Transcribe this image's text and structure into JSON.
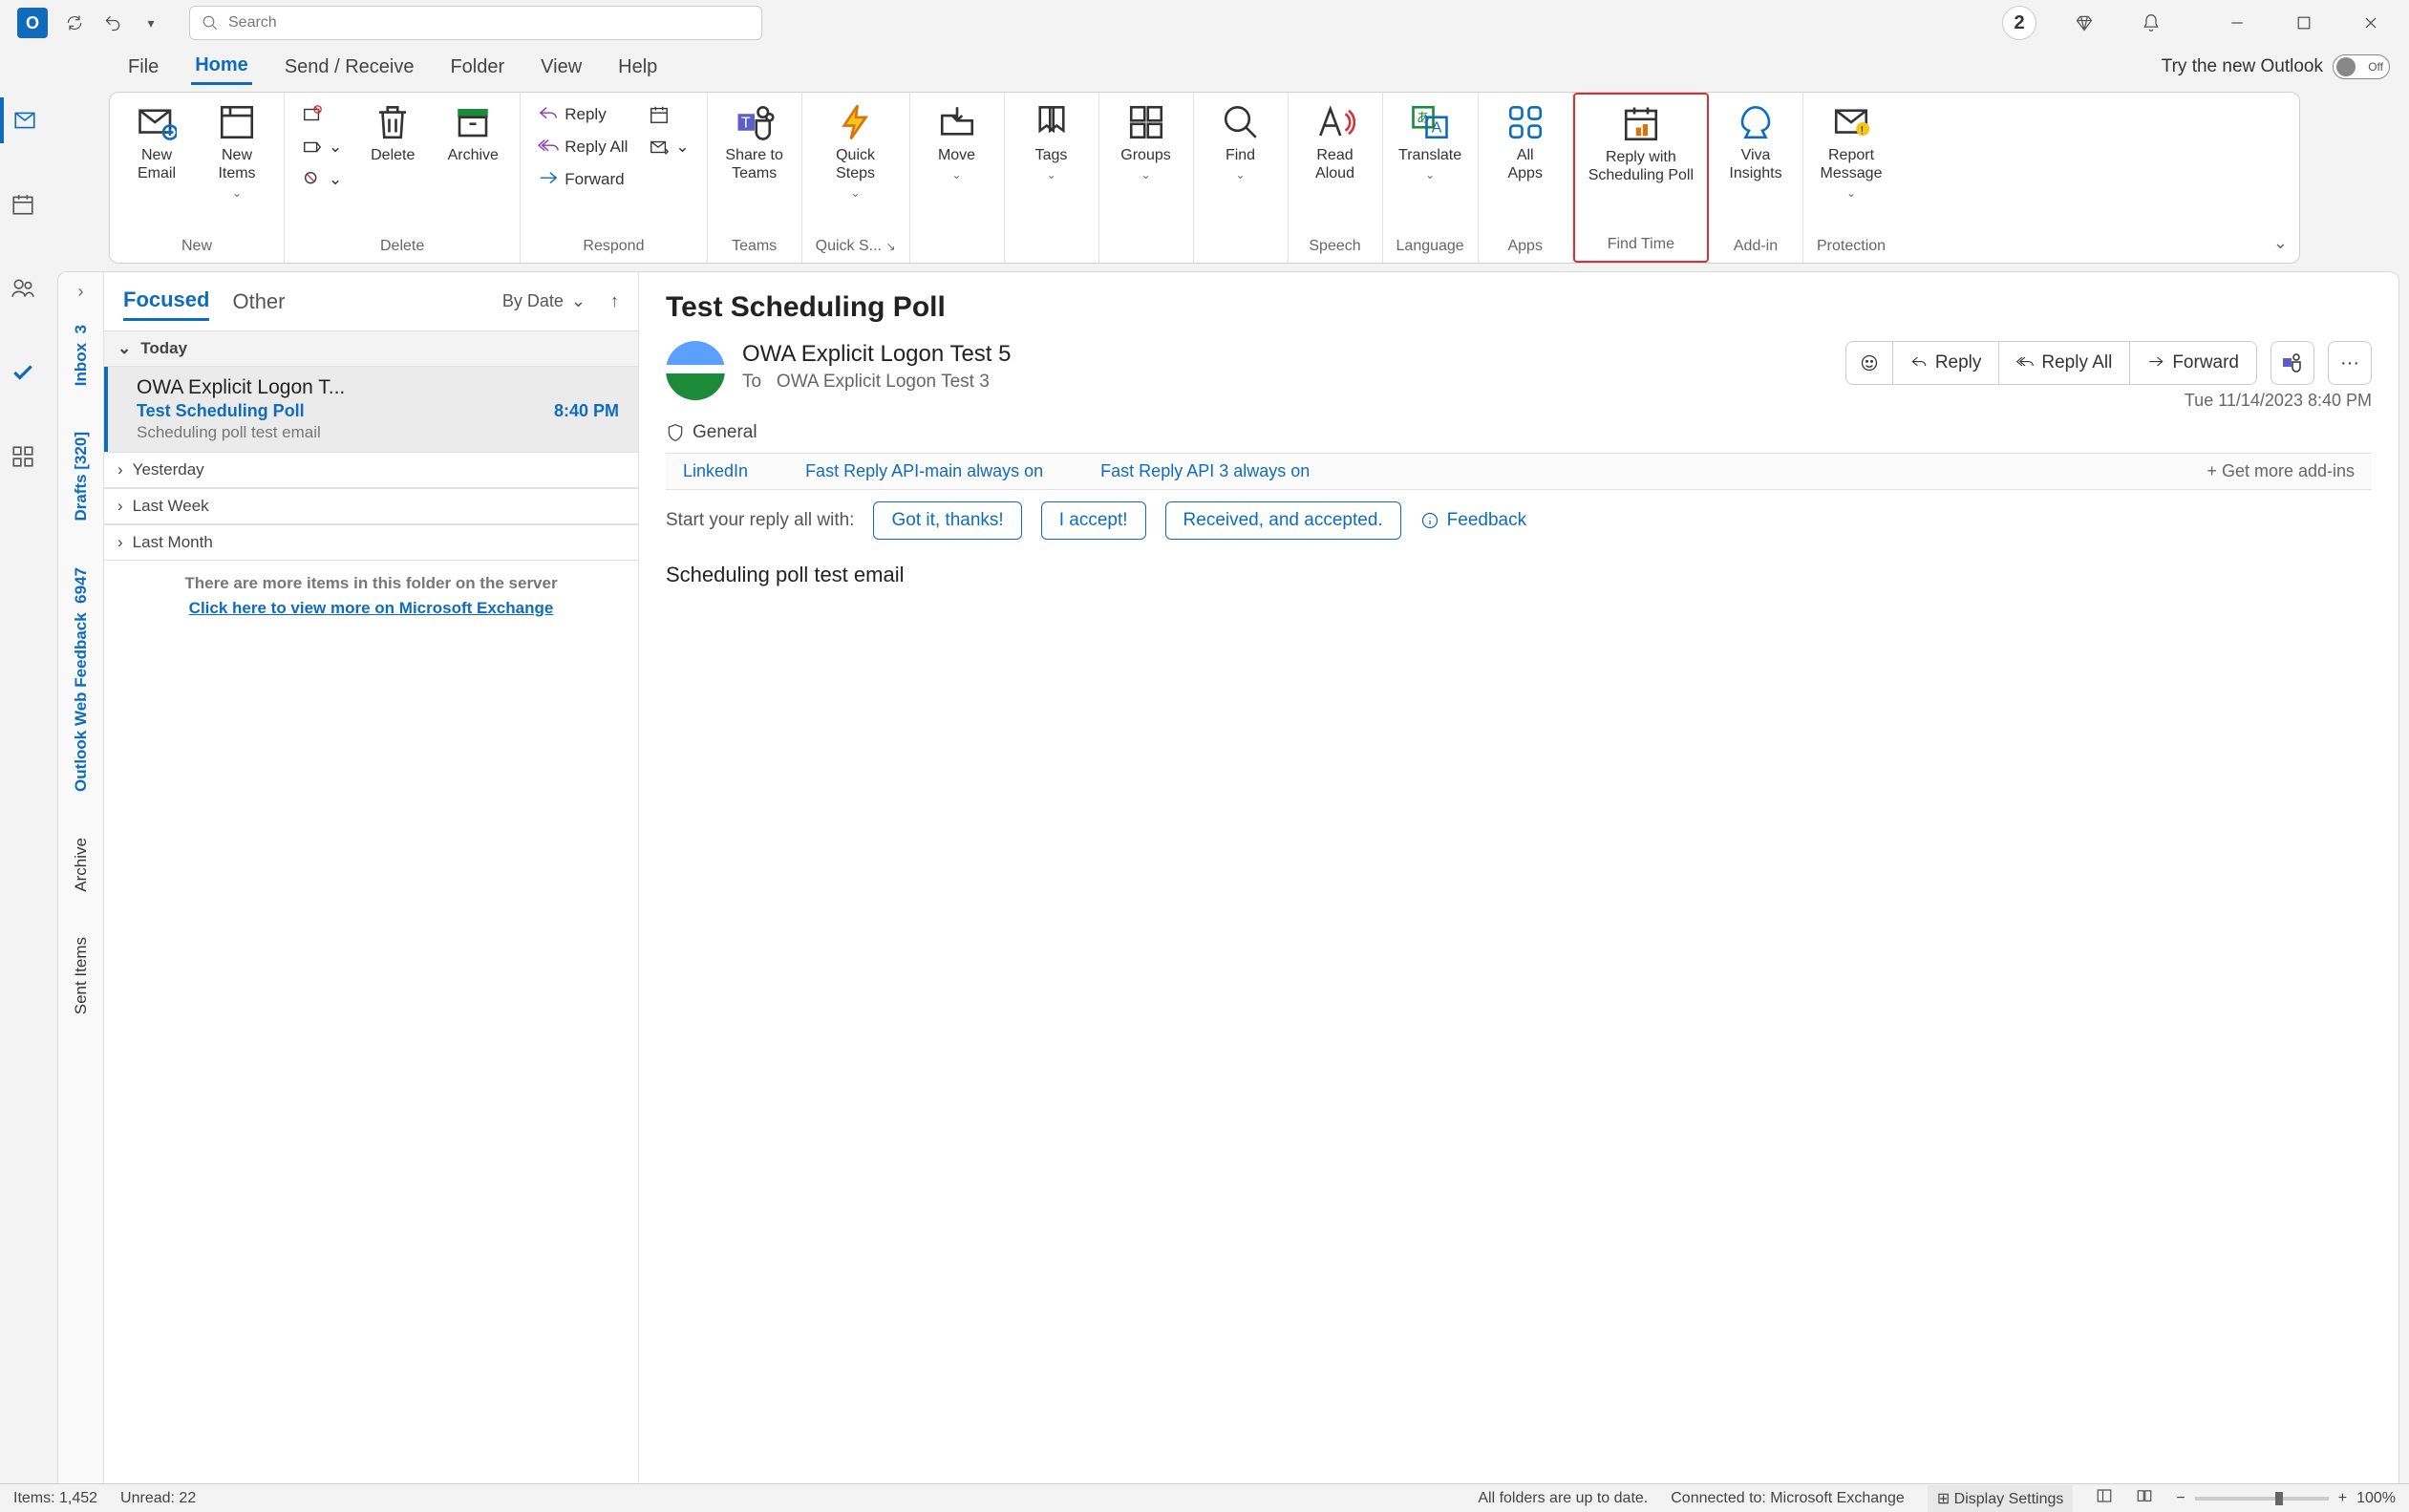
{
  "titlebar": {
    "search_placeholder": "Search",
    "notification_count": "2",
    "try_label": "Try the new Outlook",
    "toggle_state": "Off"
  },
  "menu": {
    "items": [
      "File",
      "Home",
      "Send / Receive",
      "Folder",
      "View",
      "Help"
    ],
    "active": 1
  },
  "ribbon": {
    "groups": {
      "new": {
        "label": "New",
        "new_email": "New\nEmail",
        "new_items": "New\nItems"
      },
      "delete": {
        "label": "Delete",
        "delete": "Delete",
        "archive": "Archive"
      },
      "respond": {
        "label": "Respond",
        "reply": "Reply",
        "reply_all": "Reply All",
        "forward": "Forward"
      },
      "teams": {
        "label": "Teams",
        "share": "Share to\nTeams"
      },
      "quick": {
        "label": "Quick S...",
        "steps": "Quick\nSteps"
      },
      "move": {
        "label": "",
        "move": "Move",
        "tags": "Tags",
        "groups": "Groups",
        "find": "Find"
      },
      "speech": {
        "label": "Speech",
        "read": "Read\nAloud"
      },
      "language": {
        "label": "Language",
        "translate": "Translate"
      },
      "apps": {
        "label": "Apps",
        "all_apps": "All\nApps"
      },
      "findtime": {
        "label": "Find Time",
        "reply_poll": "Reply with\nScheduling Poll"
      },
      "addin": {
        "label": "Add-in",
        "viva": "Viva\nInsights"
      },
      "protection": {
        "label": "Protection",
        "report": "Report\nMessage"
      }
    }
  },
  "vtabs": {
    "inbox": "Inbox",
    "inbox_count": "3",
    "drafts": "Drafts [320]",
    "owf": "Outlook Web Feedback",
    "owf_count": "6947",
    "archive": "Archive",
    "sent": "Sent Items"
  },
  "msglist": {
    "tabs": {
      "focused": "Focused",
      "other": "Other",
      "sort": "By Date"
    },
    "sections": {
      "today": "Today",
      "yesterday": "Yesterday",
      "lastweek": "Last Week",
      "lastmonth": "Last Month"
    },
    "item": {
      "from": "OWA Explicit Logon T...",
      "subject": "Test Scheduling Poll",
      "time": "8:40 PM",
      "preview": "Scheduling poll test email"
    },
    "more1": "There are more items in this folder on the server",
    "more2": "Click here to view more on Microsoft Exchange"
  },
  "reading": {
    "subject": "Test Scheduling Poll",
    "from": "OWA Explicit Logon Test 5",
    "to_label": "To",
    "to": "OWA Explicit Logon Test 3",
    "date": "Tue 11/14/2023 8:40 PM",
    "tag": "General",
    "actions": {
      "reply": "Reply",
      "reply_all": "Reply All",
      "forward": "Forward"
    },
    "addins": {
      "linkedin": "LinkedIn",
      "a2": "Fast Reply API-main always on",
      "a3": "Fast Reply API 3 always on",
      "get": "Get more add-ins"
    },
    "quick": {
      "label": "Start your reply all with:",
      "c1": "Got it, thanks!",
      "c2": "I accept!",
      "c3": "Received, and accepted.",
      "feedback": "Feedback"
    },
    "body": "Scheduling poll test email"
  },
  "status": {
    "items": "Items: 1,452",
    "unread": "Unread: 22",
    "sync": "All folders are up to date.",
    "conn": "Connected to: Microsoft Exchange",
    "display": "Display Settings",
    "zoom": "100%"
  }
}
